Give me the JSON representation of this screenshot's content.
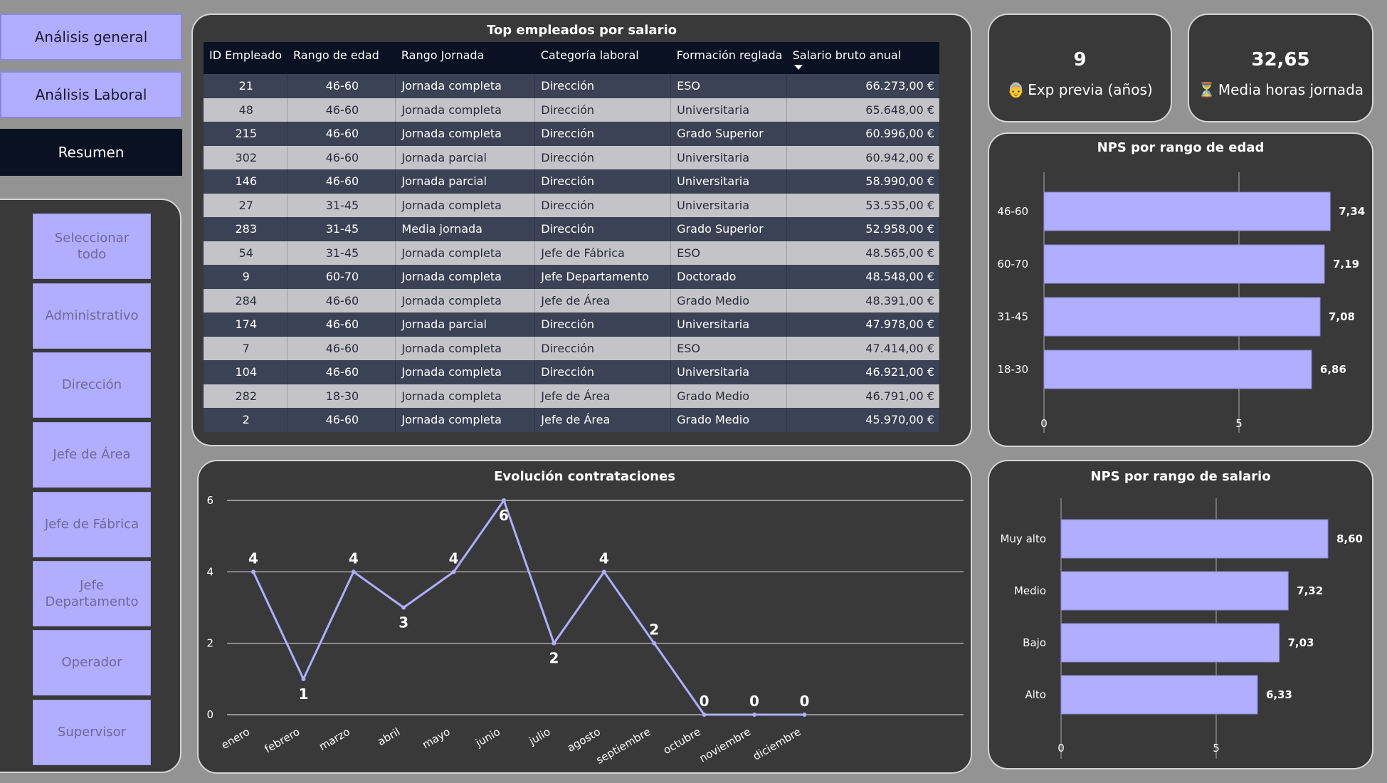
{
  "nav": {
    "general": "Análisis general",
    "laboral": "Análisis Laboral",
    "resumen": "Resumen"
  },
  "slicer": {
    "items": [
      "Seleccionar todo",
      "Administrativo",
      "Dirección",
      "Jefe de Área",
      "Jefe de Fábrica",
      "Jefe Departamento",
      "Operador",
      "Supervisor"
    ]
  },
  "table": {
    "title": "Top empleados por salario",
    "columns": [
      "ID Empleado",
      "Rango de edad",
      "Rango Jornada",
      "Categoría laboral",
      "Formación reglada",
      "Salario bruto anual"
    ],
    "rows": [
      [
        "21",
        "46-60",
        "Jornada completa",
        "Dirección",
        "ESO",
        "66.273,00 €"
      ],
      [
        "48",
        "46-60",
        "Jornada completa",
        "Dirección",
        "Universitaria",
        "65.648,00 €"
      ],
      [
        "215",
        "46-60",
        "Jornada completa",
        "Dirección",
        "Grado Superior",
        "60.996,00 €"
      ],
      [
        "302",
        "46-60",
        "Jornada parcial",
        "Dirección",
        "Universitaria",
        "60.942,00 €"
      ],
      [
        "146",
        "46-60",
        "Jornada parcial",
        "Dirección",
        "Universitaria",
        "58.990,00 €"
      ],
      [
        "27",
        "31-45",
        "Jornada completa",
        "Dirección",
        "Universitaria",
        "53.535,00 €"
      ],
      [
        "283",
        "31-45",
        "Media jornada",
        "Dirección",
        "Grado Superior",
        "52.958,00 €"
      ],
      [
        "54",
        "31-45",
        "Jornada completa",
        "Jefe de Fábrica",
        "ESO",
        "48.565,00 €"
      ],
      [
        "9",
        "60-70",
        "Jornada completa",
        "Jefe Departamento",
        "Doctorado",
        "48.548,00 €"
      ],
      [
        "284",
        "46-60",
        "Jornada completa",
        "Jefe de Área",
        "Grado Medio",
        "48.391,00 €"
      ],
      [
        "174",
        "46-60",
        "Jornada parcial",
        "Dirección",
        "Universitaria",
        "47.978,00 €"
      ],
      [
        "7",
        "46-60",
        "Jornada completa",
        "Dirección",
        "ESO",
        "47.414,00 €"
      ],
      [
        "104",
        "46-60",
        "Jornada completa",
        "Dirección",
        "Universitaria",
        "46.921,00 €"
      ],
      [
        "282",
        "18-30",
        "Jornada completa",
        "Jefe de Área",
        "Grado Medio",
        "46.791,00 €"
      ],
      [
        "2",
        "46-60",
        "Jornada completa",
        "Jefe de Área",
        "Grado Medio",
        "45.970,00 €"
      ]
    ]
  },
  "kpis": {
    "exp": {
      "value": "9",
      "icon": "👵",
      "label": "Exp previa (años)"
    },
    "horas": {
      "value": "32,65",
      "icon": "⏳",
      "label": "Media horas jornada"
    }
  },
  "colors": {
    "accent": "#b1adff",
    "panel_bg": "#393939",
    "table_header": "#0a1123",
    "line": "#b1adff"
  },
  "chart_data": [
    {
      "id": "nps_edad",
      "type": "bar",
      "orientation": "horizontal",
      "title": "NPS por rango de edad",
      "categories": [
        "46-60",
        "60-70",
        "31-45",
        "18-30"
      ],
      "values": [
        7.34,
        7.19,
        7.08,
        6.86
      ],
      "value_labels": [
        "7,34",
        "7,19",
        "7,08",
        "6,86"
      ],
      "xlim": [
        0,
        7.34
      ],
      "xticks": [
        "0",
        "5"
      ],
      "grid": true
    },
    {
      "id": "contrataciones",
      "type": "line",
      "title": "Evolución contrataciones",
      "categories": [
        "enero",
        "febrero",
        "marzo",
        "abril",
        "mayo",
        "junio",
        "julio",
        "agosto",
        "septiembre",
        "octubre",
        "noviembre",
        "diciembre"
      ],
      "values": [
        4,
        1,
        4,
        3,
        4,
        6,
        2,
        4,
        2,
        0,
        0,
        0
      ],
      "ylim": [
        0,
        6
      ],
      "yticks": [
        "0",
        "2",
        "4",
        "6"
      ],
      "grid": true
    },
    {
      "id": "nps_salario",
      "type": "bar",
      "orientation": "horizontal",
      "title": "NPS por rango de salario",
      "categories": [
        "Muy alto",
        "Medio",
        "Bajo",
        "Alto"
      ],
      "values": [
        8.6,
        7.32,
        7.03,
        6.33
      ],
      "value_labels": [
        "8,60",
        "7,32",
        "7,03",
        "6,33"
      ],
      "xlim": [
        0,
        8.6
      ],
      "xticks": [
        "0",
        "5"
      ],
      "grid": true
    }
  ]
}
